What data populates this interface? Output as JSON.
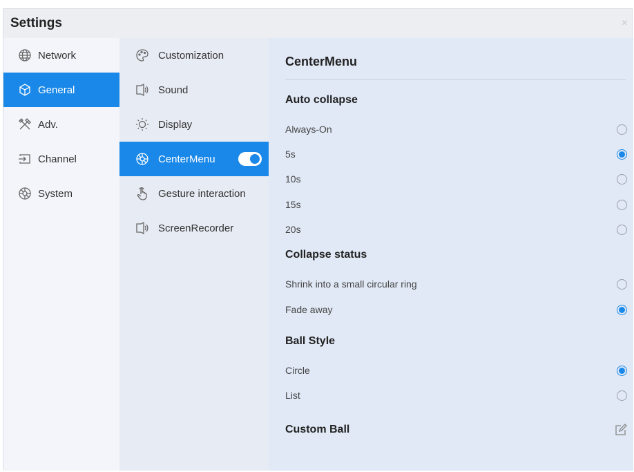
{
  "window": {
    "title": "Settings",
    "close_glyph": "×"
  },
  "categories": [
    {
      "label": "Network",
      "icon": "globe-icon"
    },
    {
      "label": "General",
      "icon": "cube-icon",
      "active": true
    },
    {
      "label": "Adv.",
      "icon": "tools-icon"
    },
    {
      "label": "Channel",
      "icon": "input-icon"
    },
    {
      "label": "System",
      "icon": "aperture-icon"
    }
  ],
  "submenu": [
    {
      "label": "Customization",
      "icon": "palette-icon"
    },
    {
      "label": "Sound",
      "icon": "speaker-icon"
    },
    {
      "label": "Display",
      "icon": "sun-icon"
    },
    {
      "label": "CenterMenu",
      "icon": "aperture-icon",
      "active": true,
      "toggle": "on"
    },
    {
      "label": "Gesture interaction",
      "icon": "hand-icon"
    },
    {
      "label": "ScreenRecorder",
      "icon": "speaker-icon"
    }
  ],
  "panel": {
    "title": "CenterMenu",
    "auto_collapse": {
      "heading": "Auto collapse",
      "options": [
        {
          "label": "Always-On",
          "selected": false
        },
        {
          "label": "5s",
          "selected": true
        },
        {
          "label": "10s",
          "selected": false
        },
        {
          "label": "15s",
          "selected": false
        },
        {
          "label": "20s",
          "selected": false
        }
      ]
    },
    "collapse_status": {
      "heading": "Collapse status",
      "options": [
        {
          "label": "Shrink into a small circular ring",
          "selected": false
        },
        {
          "label": "Fade away",
          "selected": true
        }
      ]
    },
    "ball_style": {
      "heading": "Ball Style",
      "options": [
        {
          "label": "Circle",
          "selected": true
        },
        {
          "label": "List",
          "selected": false
        }
      ]
    },
    "custom_ball": {
      "heading": "Custom Ball",
      "icon": "edit-icon"
    }
  },
  "colors": {
    "accent": "#1a88e8",
    "panel_bg": "#e1e9f6",
    "submenu_bg": "#e7ebf4",
    "sidebar_bg": "#f3f5fa"
  }
}
